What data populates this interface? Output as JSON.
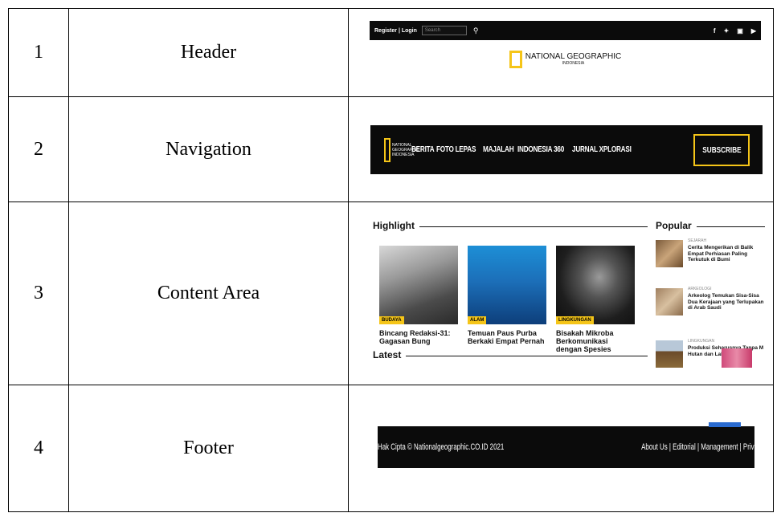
{
  "rows": [
    {
      "number": "1",
      "label": "Header"
    },
    {
      "number": "2",
      "label": "Navigation"
    },
    {
      "number": "3",
      "label": "Content Area"
    },
    {
      "number": "4",
      "label": "Footer"
    }
  ],
  "header_shot": {
    "register_login": "Register | Login",
    "search_placeholder": "Search",
    "logo_text": "NATIONAL GEOGRAPHIC",
    "logo_sub": "INDONESIA",
    "social_icons": [
      "facebook-icon",
      "twitter-icon",
      "instagram-icon",
      "youtube-icon"
    ]
  },
  "nav_shot": {
    "logo_line1": "NATIONAL",
    "logo_line2": "GEOGRAPHIC",
    "logo_line3": "INDONESIA",
    "items": [
      "BERITA",
      "FOTO LEPAS",
      "MAJALAH",
      "INDONESIA 360",
      "JURNAL XPLORASI"
    ],
    "subscribe": "SUBSCRIBE"
  },
  "content_shot": {
    "highlight_title": "Highlight",
    "popular_title": "Popular",
    "latest_title": "Latest",
    "cards": [
      {
        "tag": "BUDAYA",
        "title": "Bincang Redaksi-31: Gagasan Bung"
      },
      {
        "tag": "ALAM",
        "title": "Temuan Paus Purba Berkaki Empat Pernah"
      },
      {
        "tag": "LINGKUNGAN",
        "title": "Bisakah Mikroba Berkomunikasi dengan Spesies"
      }
    ],
    "popular": [
      {
        "category": "SEJARAH",
        "title": "Cerita Mengerikan di Balik Empat Perhiasan Paling Terkutuk di Bumi"
      },
      {
        "category": "ARKEOLOGI",
        "title": "Arkeolog Temukan Sisa-Sisa Dua Kerajaan yang Terlupakan di Arab Saudi"
      },
      {
        "category": "LINGKUNGAN",
        "title": "Produksi Seharusnya Tanpa M Hutan dan Lahan Gambut"
      }
    ]
  },
  "footer_shot": {
    "copyright": "Hak Cipta © Nationalgeographic.CO.ID 2021",
    "links": "About Us | Editorial | Management | Privacy | Pedoman Media Siber | Contact Us"
  },
  "colors": {
    "accent": "#f5c518",
    "dark": "#0b0b0b"
  }
}
